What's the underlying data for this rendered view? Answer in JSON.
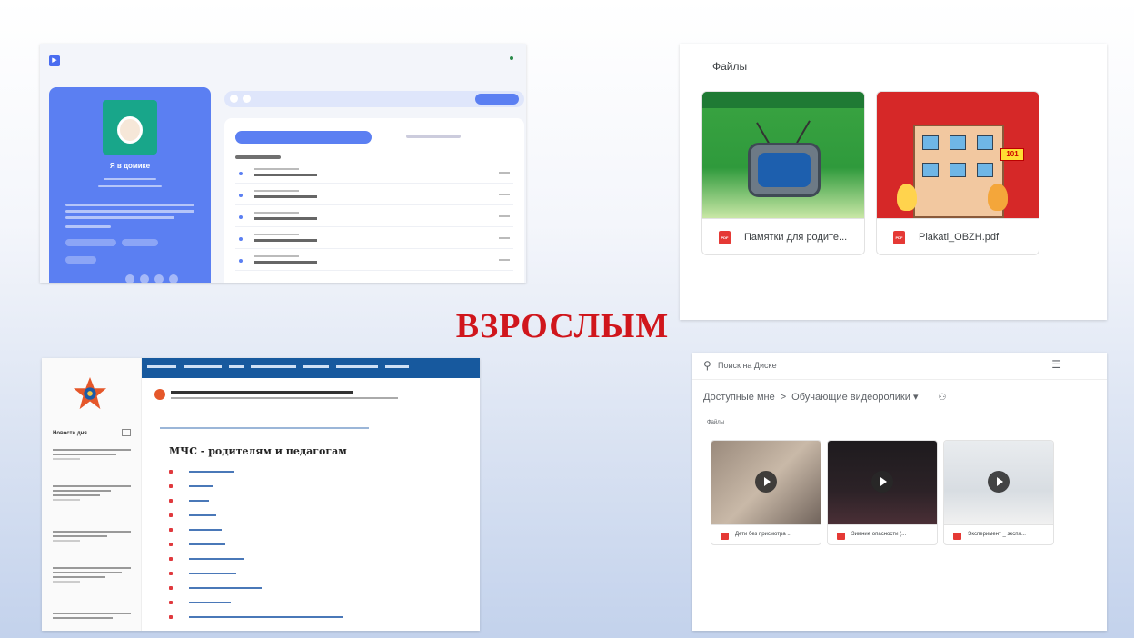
{
  "headline": "ВЗРОСЛЫМ",
  "files_panel": {
    "title": "Файлы",
    "files": [
      {
        "name": "Памятки для родите...",
        "type": "pdf"
      },
      {
        "name": "Plakati_OBZH.pdf",
        "type": "pdf"
      }
    ],
    "thumb2_badge": "101"
  },
  "drive_panel": {
    "search_placeholder": "Поиск на Диске",
    "breadcrumb": [
      "Доступные мне",
      "Обучающие видеоролики"
    ],
    "section": "Файлы",
    "videos": [
      {
        "name": "Дети без присмотра ..."
      },
      {
        "name": "Зимние опасности (..."
      },
      {
        "name": "Эксперимент _ экспл..."
      }
    ]
  },
  "mchs_panel": {
    "page_title": "МЧС - родителям и педагогам",
    "news_heading": "Новости дня"
  },
  "podcast_panel": {
    "show_name": "Я в домике"
  },
  "colors": {
    "headline": "#d0161c",
    "mchs_nav": "#17599e",
    "podcast_card": "#5b7ff2",
    "pdf_red": "#e53935"
  }
}
